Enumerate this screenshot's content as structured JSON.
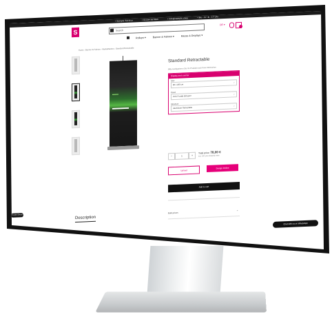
{
  "topbar": {
    "items": [
      "• Sample Service",
      "• 01234 567890",
      "• info@sample.shop",
      "• Mo - Fr: 8 - 17 Uhr"
    ]
  },
  "header": {
    "logo_text": "S",
    "search_placeholder": "Search",
    "lang": "DE ▾"
  },
  "nav": {
    "items": [
      "Rollups ▾",
      "Banner & Fahnen ▾",
      "Messe & Displays ▾"
    ]
  },
  "breadcrumb": "Home › Banner & Fahnen › Werbeflächen › Standard Retractable",
  "product": {
    "title": "Standard Retractable",
    "subtitle": "Bitte konfigurieren Sie Ihr Produkt nach Ihren Wünschen",
    "config_title": "Display and counter",
    "fields": [
      {
        "label": "Size",
        "value": "85 x 200 cm"
      },
      {
        "label": "Panel",
        "value": "PVC Frontlit 500 g/m²"
      },
      {
        "label": "Structure",
        "value": "Aluminium Retractable"
      }
    ],
    "quantity": "1",
    "price_prefix": "Total price:",
    "price": "78,00 €",
    "price_note": "incl. VAT, plus shipping costs",
    "upload_label": "Upload",
    "design_label": "Design Online",
    "add_to_cart": "Add to cart",
    "accordion": "Bulk prices"
  },
  "description_tab": "Description",
  "left_pill": "Trusted Shops",
  "whatsapp": "Chat with us on WhatsApp",
  "colors": {
    "brand": "#d8006f",
    "dark": "#111111"
  }
}
